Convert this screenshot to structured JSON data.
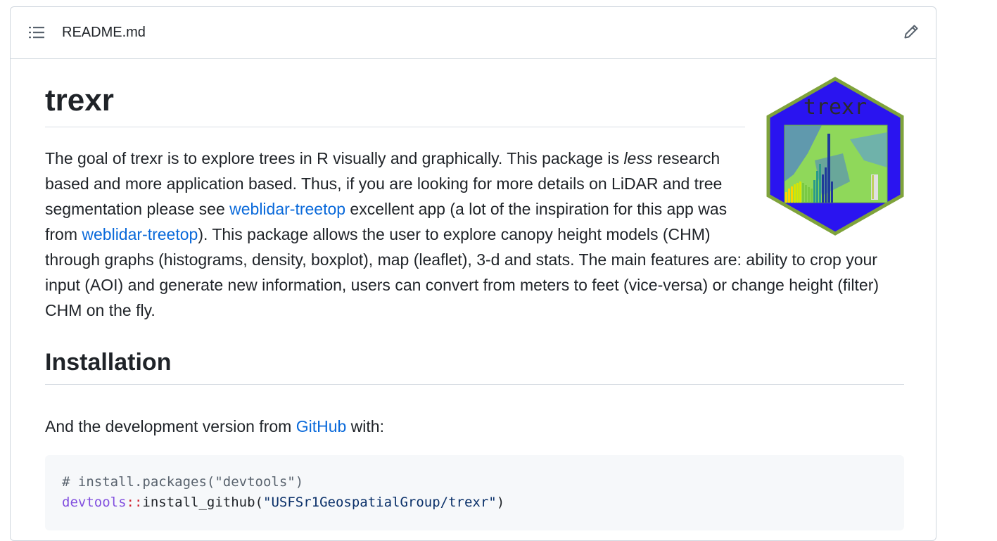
{
  "header": {
    "filename": "README.md",
    "toc_icon": "list-unordered-icon",
    "edit_icon": "pencil-icon"
  },
  "readme": {
    "title": "trexr",
    "logo_text": "trexr",
    "intro": {
      "p1": "The goal of trexr is to explore trees in R visually and graphically. This package is ",
      "em": "less",
      "p2": " research based and more application based. Thus, if you are looking for more details on LiDAR and tree segmentation please see ",
      "link1": "weblidar-treetop",
      "p3": " excellent app (a lot of the inspiration for this app was from ",
      "link2": "weblidar-treetop",
      "p4": "). This package allows the user to explore canopy height models (CHM) through graphs (histograms, density, boxplot), map (leaflet), 3-d and stats. The main features are: ability to crop your input (AOI) and generate new information, users can convert from meters to feet (vice-versa) or change height (filter) CHM on the fly."
    },
    "installation": {
      "heading": "Installation",
      "text_before": "And the development version from ",
      "link": "GitHub",
      "text_after": " with:",
      "code": {
        "line1_comment": "# install.packages(\"devtools\")",
        "line2_ns": "devtools",
        "line2_op": "::",
        "line2_fn": "install_github(",
        "line2_str": "\"USFSr1GeospatialGroup/trexr\"",
        "line2_end": ")"
      }
    }
  },
  "colors": {
    "link": "#0969da",
    "border": "#d0d7de",
    "code_bg": "#f6f8fa",
    "logo_border": "#7fa33b",
    "logo_fill": "#2a14f0"
  }
}
